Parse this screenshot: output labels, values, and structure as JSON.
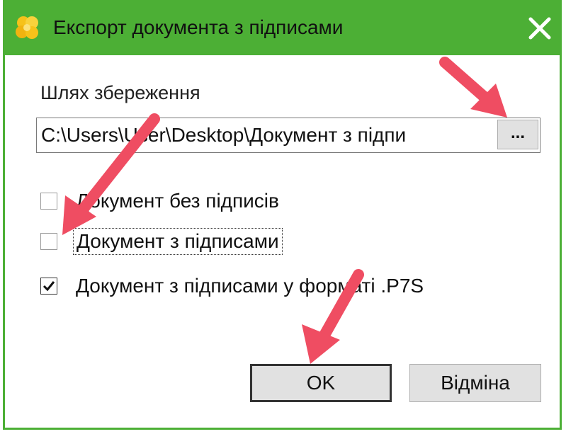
{
  "window": {
    "title": "Експорт документа з підписами",
    "icon": "flower-logo-icon",
    "close_icon": "close-icon"
  },
  "path": {
    "label": "Шлях збереження",
    "value": "C:\\Users\\User\\Desktop\\Документ з підпи",
    "browse_label": "..."
  },
  "options": [
    {
      "label": "Документ без підписів",
      "checked": false
    },
    {
      "label": "Документ з підписами",
      "checked": false,
      "focused": true
    },
    {
      "label": "Документ з підписами у форматі .P7S",
      "checked": true
    }
  ],
  "buttons": {
    "ok": "OK",
    "cancel": "Відміна"
  },
  "colors": {
    "titlebar": "#4caf35",
    "arrow": "#ef4d62"
  }
}
